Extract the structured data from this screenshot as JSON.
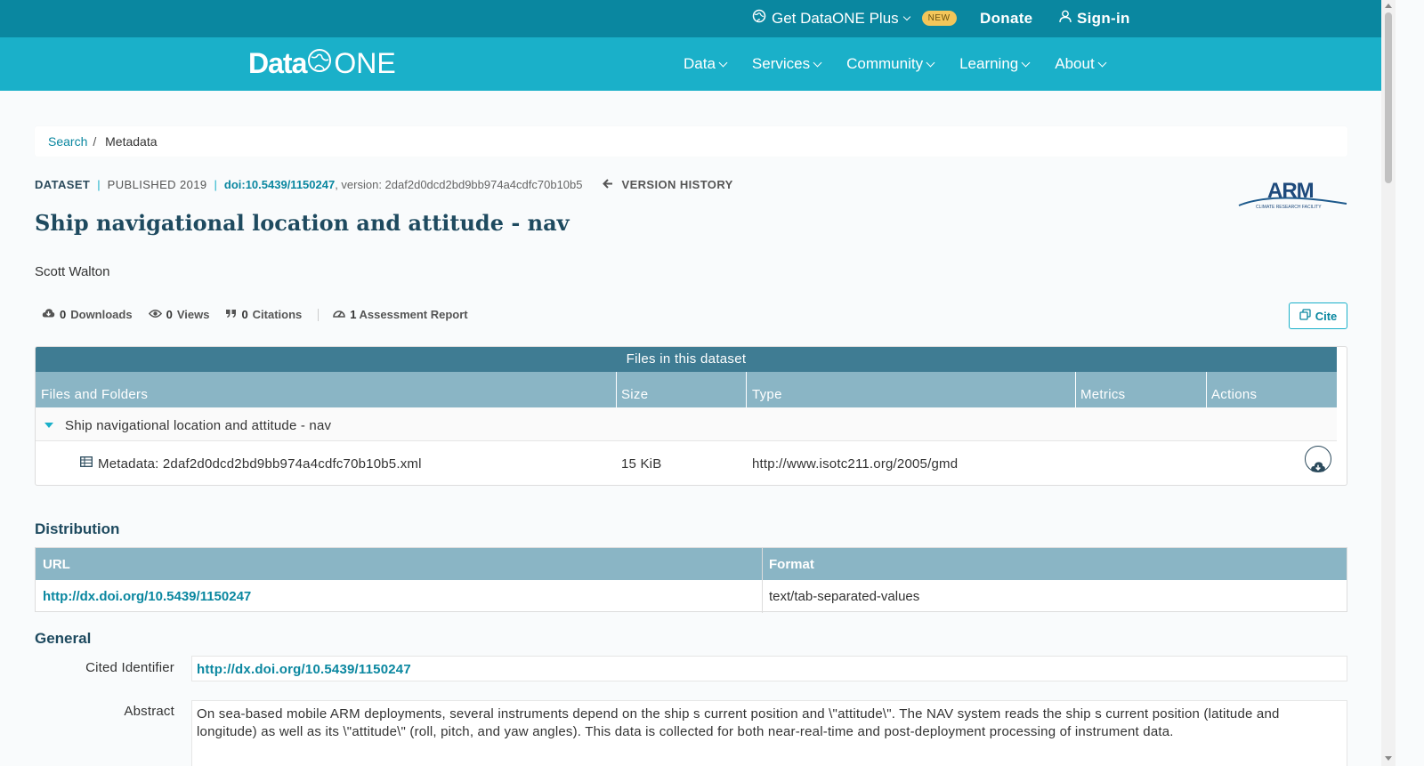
{
  "topbar": {
    "plus_label": "Get DataONE Plus",
    "new_badge": "NEW",
    "donate": "Donate",
    "signin": "Sign-in"
  },
  "logo": {
    "data": "Data",
    "one": "ONE"
  },
  "nav": [
    "Data",
    "Services",
    "Community",
    "Learning",
    "About"
  ],
  "breadcrumb": {
    "search": "Search",
    "current": "Metadata"
  },
  "meta": {
    "dataset": "DATASET",
    "published": "PUBLISHED 2019",
    "doi": "doi:10.5439/1150247",
    "version": ", version: 2daf2d0dcd2bd9bb974a4cdfc70b10b5",
    "version_history": "VERSION HISTORY"
  },
  "title": "Ship navigational location and attitude - nav",
  "author": "Scott Walton",
  "arm_logo": {
    "text": "ARM",
    "sub": "CLIMATE RESEARCH FACILITY"
  },
  "metrics": {
    "downloads_num": "0",
    "downloads": "Downloads",
    "views_num": "0",
    "views": "Views",
    "citations_num": "0",
    "citations": "Citations",
    "assess_num": "1",
    "assess": "Assessment Report"
  },
  "cite": "Cite",
  "files": {
    "header": "Files in this dataset",
    "columns": [
      "Files and Folders",
      "Size",
      "Type",
      "Metrics",
      "Actions"
    ],
    "folder": "Ship navigational location and attitude - nav",
    "file_name": "Metadata: 2daf2d0dcd2bd9bb974a4cdfc70b10b5.xml",
    "file_size": "15 KiB",
    "file_type": "http://www.isotc211.org/2005/gmd"
  },
  "distribution": {
    "heading": "Distribution",
    "col_url": "URL",
    "col_format": "Format",
    "url": "http://dx.doi.org/10.5439/1150247",
    "format": "text/tab-separated-values"
  },
  "general": {
    "heading": "General",
    "cited_label": "Cited Identifier",
    "cited_value": "http://dx.doi.org/10.5439/1150247",
    "abstract_label": "Abstract",
    "abstract_value": "On sea-based mobile ARM deployments, several instruments depend on the ship s current position and \\\"attitude\\\". The NAV system reads the ship s current position (latitude and longitude) as well as its \\\"attitude\\\" (roll, pitch, and yaw angles). This data is collected for both near-real-time and post-deployment processing of instrument data."
  }
}
